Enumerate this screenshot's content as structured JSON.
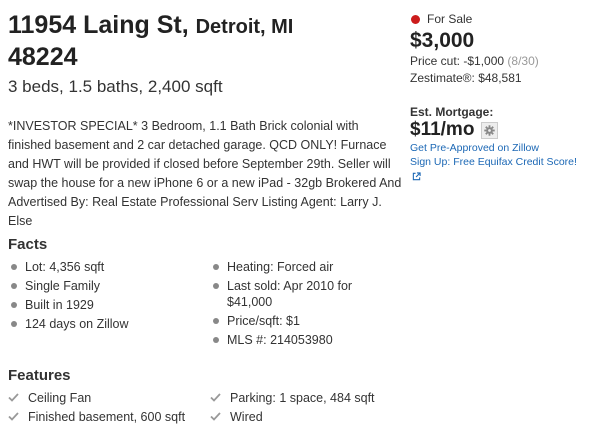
{
  "listing": {
    "street": "11954 Laing St,",
    "city_state": "Detroit, MI",
    "zip": "48224",
    "beds_baths_sqft": "3 beds, 1.5 baths, 2,400 sqft",
    "description": "*INVESTOR SPECIAL* 3 Bedroom, 1.1 Bath Brick colonial with finished basement and 2 car detached garage. QCD ONLY! Furnace and HWT will be provided if closed before September 29th. Seller will swap the house for a new iPhone 6 or a new iPad - 32gb Brokered And Advertised By: Real Estate Professional Serv Listing Agent: Larry J. Else"
  },
  "sidebar": {
    "status": "For Sale",
    "status_color": "#cc1c1c",
    "price": "$3,000",
    "price_cut_label": "Price cut: -$1,000",
    "price_cut_date": "(8/30)",
    "zestimate": "Zestimate®: $48,581",
    "mortgage_label": "Est. Mortgage:",
    "mortgage_value": "$11/mo",
    "preapproved_link": "Get Pre-Approved on Zillow",
    "credit_link": "Sign Up: Free Equifax Credit Score!",
    "link_color": "#1c68b5"
  },
  "facts": {
    "title": "Facts",
    "col1": [
      "Lot: 4,356 sqft",
      "Single Family",
      "Built in 1929",
      "124 days on Zillow"
    ],
    "col2": [
      "Heating: Forced air",
      "Last sold: Apr 2010 for $41,000",
      "Price/sqft: $1",
      "MLS #: 214053980"
    ]
  },
  "features": {
    "title": "Features",
    "col1": [
      "Ceiling Fan",
      "Finished basement, 600 sqft"
    ],
    "col2": [
      "Parking: 1 space, 484 sqft",
      "Wired"
    ]
  }
}
